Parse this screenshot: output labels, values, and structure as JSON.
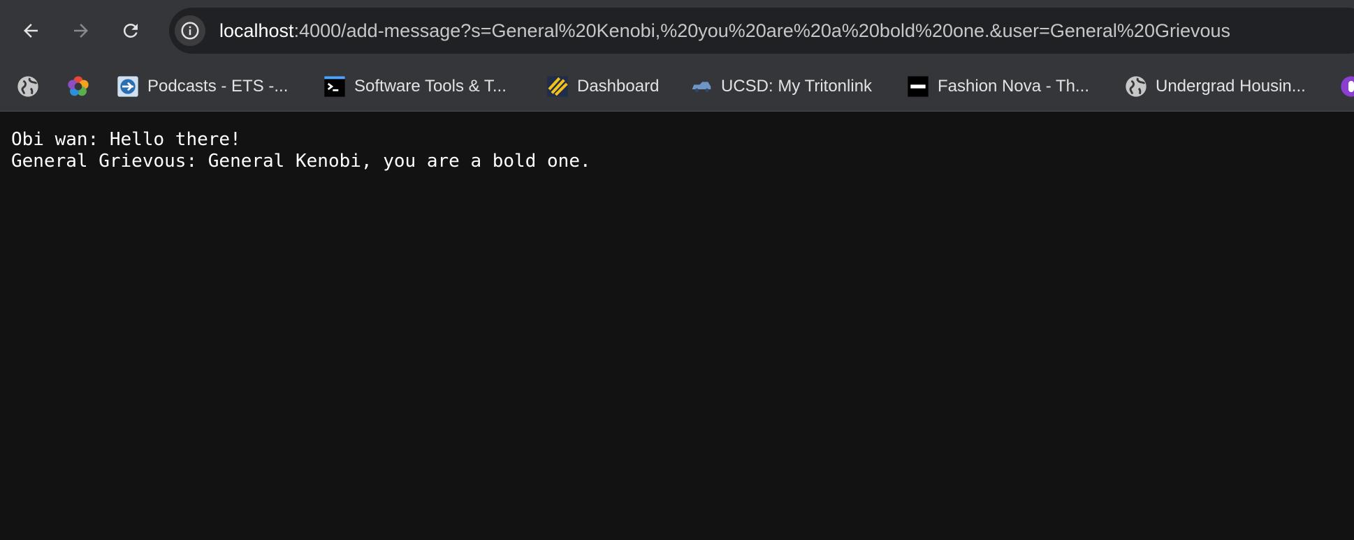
{
  "browser": {
    "url_host": "localhost",
    "url_rest": ":4000/add-message?s=General%20Kenobi,%20you%20are%20a%20bold%20one.&user=General%20Grievous",
    "back_icon": "arrow-left-icon",
    "forward_icon": "arrow-right-icon",
    "reload_icon": "reload-icon",
    "info_icon": "info-icon"
  },
  "bookmarks": [
    {
      "label": "",
      "icon": "globe-icon"
    },
    {
      "label": "",
      "icon": "colorful-ring-icon"
    },
    {
      "label": "Podcasts - ETS -...",
      "icon": "podcast-logo-icon"
    },
    {
      "label": "Software Tools & T...",
      "icon": "terminal-icon"
    },
    {
      "label": "Dashboard",
      "icon": "dashboard-stripes-icon"
    },
    {
      "label": "UCSD: My Tritonlink",
      "icon": "car-icon"
    },
    {
      "label": "Fashion Nova - Th...",
      "icon": "fashion-nova-logo-icon"
    },
    {
      "label": "Undergrad Housin...",
      "icon": "globe-icon"
    },
    {
      "label": "",
      "icon": "purple-circle-icon"
    }
  ],
  "messages": [
    "Obi wan: Hello there!",
    "General Grievous: General Kenobi, you are a bold one."
  ],
  "colors": {
    "toolbar": "#35363a",
    "omnibox": "#202124",
    "page_background": "#121212",
    "text": "#ffffff"
  }
}
